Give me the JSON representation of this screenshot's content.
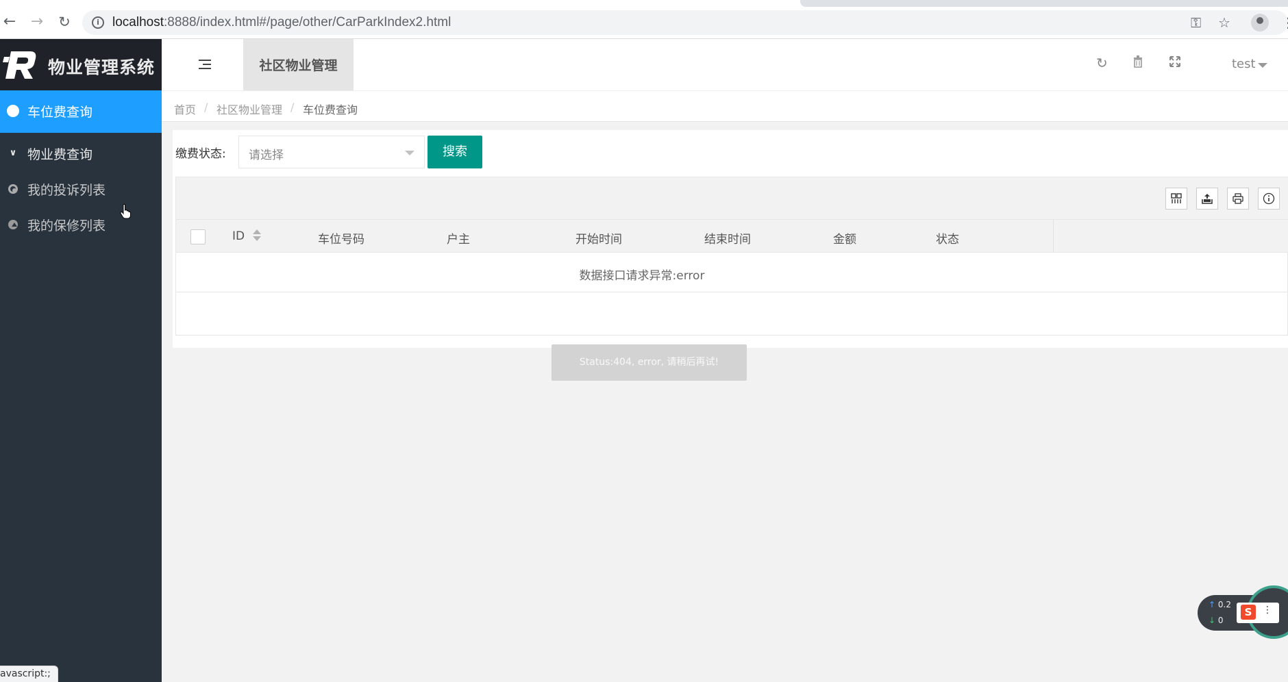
{
  "browser": {
    "url_host": "localhost",
    "url_rest": ":8888/index.html#/page/other/CarParkIndex2.html",
    "back_icon": "arrow-left-icon",
    "forward_icon": "arrow-right-icon",
    "reload_icon": "reload-icon"
  },
  "app": {
    "title": "物业管理系统"
  },
  "sidebar": {
    "items": [
      {
        "label": "车位费查询",
        "icon": "dashboard-icon"
      },
      {
        "label": "物业费查询",
        "icon": "chevron-double-down-icon"
      },
      {
        "label": "我的投诉列表",
        "icon": "target-icon"
      },
      {
        "label": "我的保修列表",
        "icon": "disc-icon"
      }
    ]
  },
  "header": {
    "tab_label": "社区物业管理",
    "user": "test"
  },
  "breadcrumb": {
    "home": "首页",
    "sep": "/",
    "section": "社区物业管理",
    "current": "车位费查询"
  },
  "filter": {
    "label": "缴费状态:",
    "placeholder": "请选择",
    "search_label": "搜索"
  },
  "table": {
    "columns": [
      "ID",
      "车位号码",
      "户主",
      "开始时间",
      "结束时间",
      "金额",
      "状态"
    ],
    "empty_message": "数据接口请求异常:error"
  },
  "toast": {
    "text": "Status:404, error, 请稍后再试!"
  },
  "network": {
    "up": "0.2",
    "down": "0"
  },
  "statusbar": {
    "text": "avascript:;"
  },
  "colors": {
    "sidebar_bg": "#28333e",
    "active_blue": "#1e9fff",
    "search_green": "#009688"
  }
}
